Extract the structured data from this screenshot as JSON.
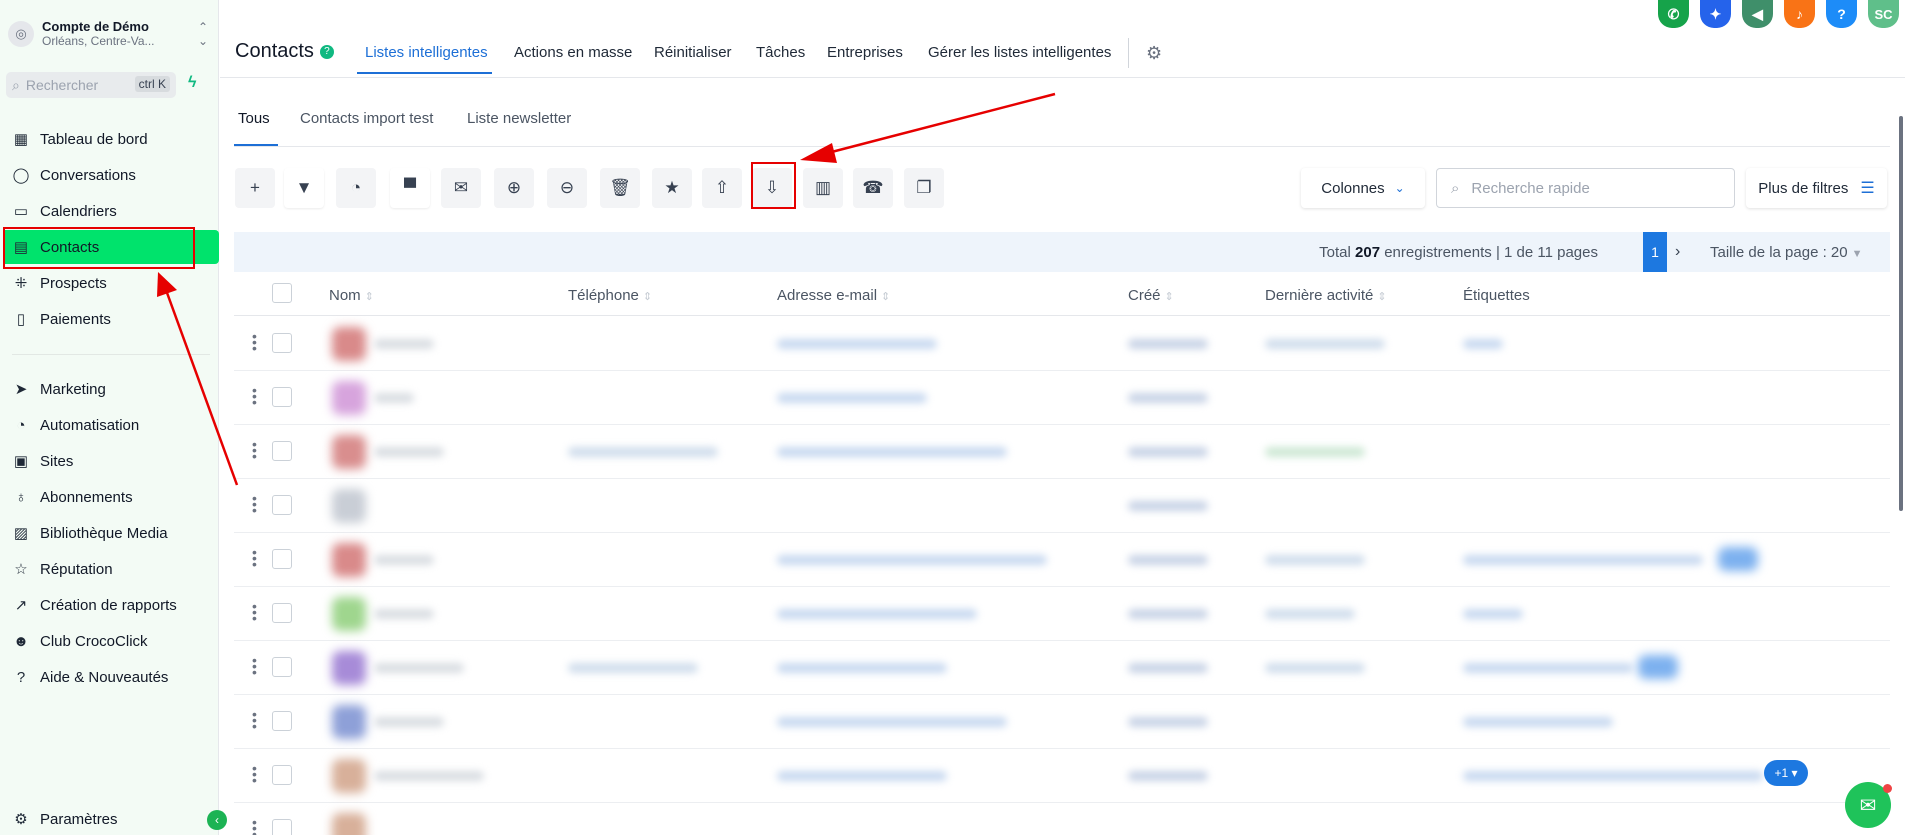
{
  "account": {
    "name": "Compte de Démo",
    "location": "Orléans, Centre-Va..."
  },
  "search": {
    "placeholder": "Rechercher",
    "shortcut": "ctrl K"
  },
  "sidebar": {
    "items": [
      {
        "label": "Tableau de bord",
        "icon": "dashboard-icon"
      },
      {
        "label": "Conversations",
        "icon": "chat-bubble-icon"
      },
      {
        "label": "Calendriers",
        "icon": "calendar-icon"
      },
      {
        "label": "Contacts",
        "icon": "contacts-book-icon",
        "active": true
      },
      {
        "label": "Prospects",
        "icon": "pipeline-icon"
      },
      {
        "label": "Paiements",
        "icon": "receipt-icon"
      },
      {
        "label": "Marketing",
        "icon": "send-icon"
      },
      {
        "label": "Automatisation",
        "icon": "automation-icon"
      },
      {
        "label": "Sites",
        "icon": "sites-icon"
      },
      {
        "label": "Abonnements",
        "icon": "award-icon"
      },
      {
        "label": "Bibliothèque Media",
        "icon": "image-icon"
      },
      {
        "label": "Réputation",
        "icon": "star-icon"
      },
      {
        "label": "Création de rapports",
        "icon": "trend-icon"
      },
      {
        "label": "Club CrocoClick",
        "icon": "users-icon"
      },
      {
        "label": "Aide & Nouveautés",
        "icon": "question-icon"
      }
    ],
    "settings_label": "Paramètres"
  },
  "header": {
    "title": "Contacts",
    "tabs": [
      "Listes intelligentes",
      "Actions en masse",
      "Réinitialiser",
      "Tâches",
      "Entreprises",
      "Gérer les listes intelligentes"
    ],
    "active_tab": "Listes intelligentes",
    "user_initials": "SC"
  },
  "subtabs": [
    "Tous",
    "Contacts import test",
    "Liste newsletter"
  ],
  "toolbar": {
    "columns_label": "Colonnes",
    "quick_search_placeholder": "Recherche rapide",
    "more_filters_label": "Plus de filtres"
  },
  "pagination": {
    "total_prefix": "Total",
    "total_count": "207",
    "total_suffix": "enregistrements",
    "page_info": "1 de 11 pages",
    "current_page": "1",
    "page_size_label": "Taille de la page : 20"
  },
  "table": {
    "columns": [
      "Nom",
      "Téléphone",
      "Adresse e-mail",
      "Créé",
      "Dernière activité",
      "Étiquettes"
    ],
    "extra_tag_badge": "+1"
  },
  "colors": {
    "accent": "#1d6fd6",
    "active_nav": "#00e36c",
    "annotation": "#e60000"
  }
}
